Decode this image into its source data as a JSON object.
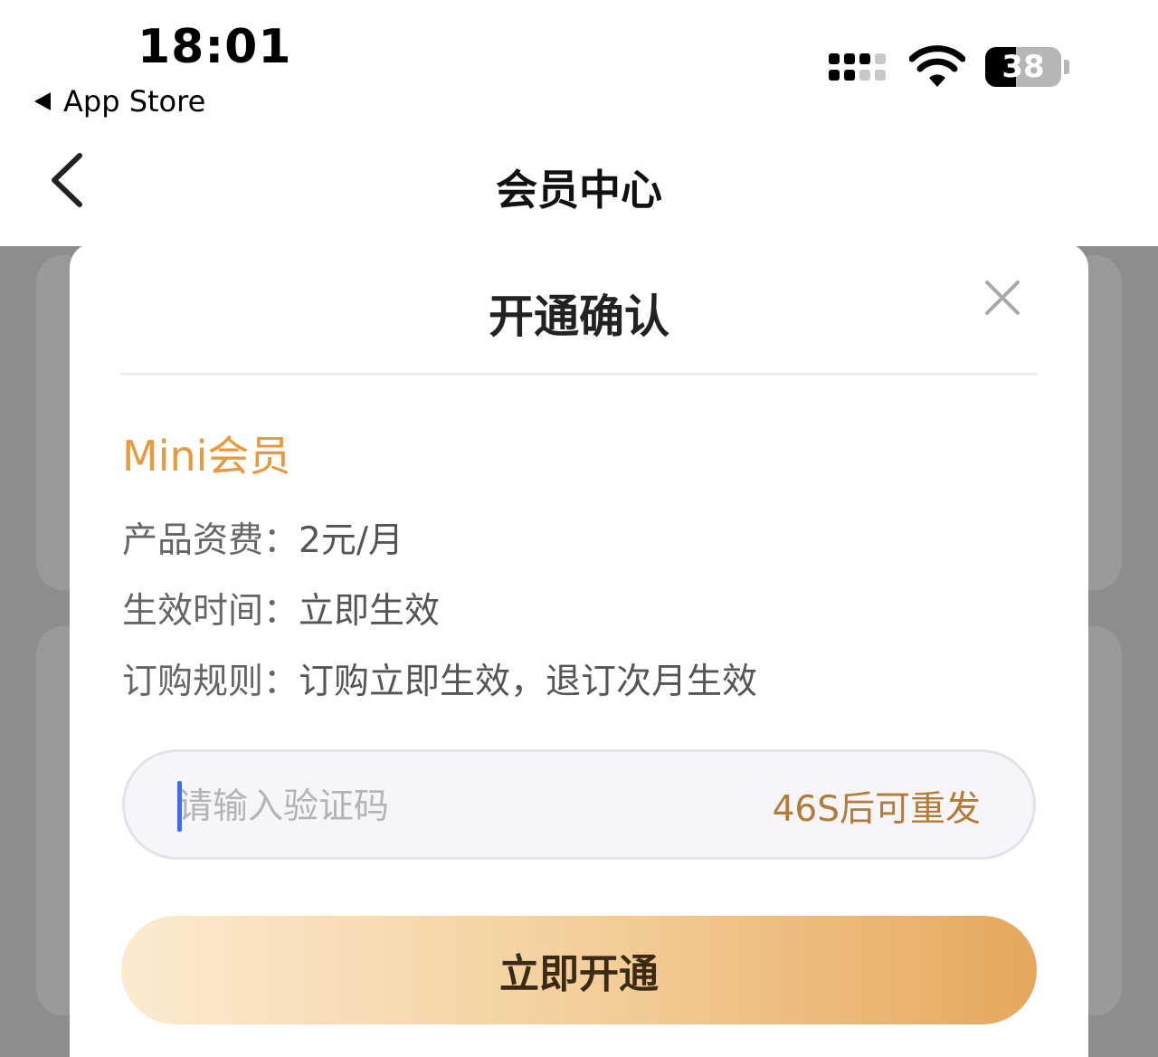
{
  "status_bar": {
    "time": "18:01",
    "back_app": "App Store",
    "battery": "38"
  },
  "nav": {
    "title": "会员中心"
  },
  "dialog": {
    "title": "开通确认",
    "plan_name": "Mini会员",
    "rows": [
      {
        "label": "产品资费：",
        "value": "2元/月"
      },
      {
        "label": "生效时间：",
        "value": "立即生效"
      },
      {
        "label": "订购规则：",
        "value": "订购立即生效，退订次月生效"
      }
    ],
    "code_placeholder": "请输入验证码",
    "code_value": "",
    "resend_label": "46S后可重发",
    "confirm_label": "立即开通"
  },
  "colors": {
    "accent_orange": "#e59a3e",
    "resend_brown": "#b57a35",
    "cursor_blue": "#3b6ff0"
  }
}
